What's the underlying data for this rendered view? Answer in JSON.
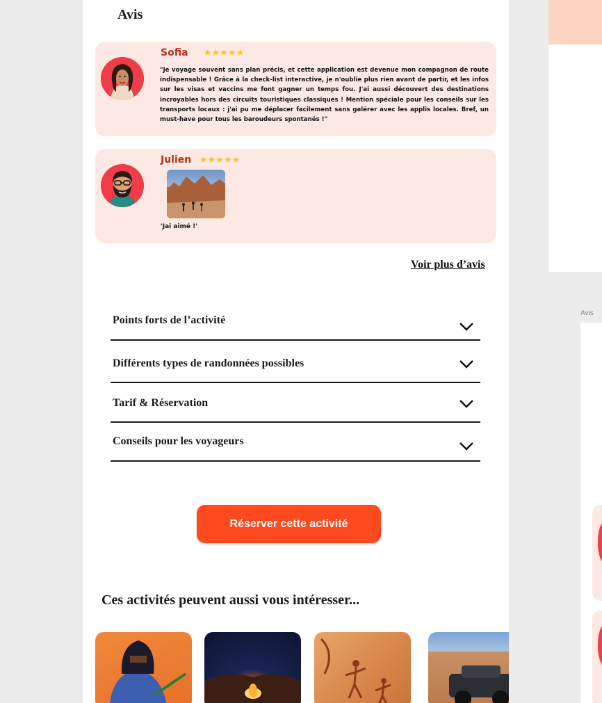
{
  "reviews": {
    "title": "Avis",
    "items": [
      {
        "name": "Sofia",
        "stars": "★★★★★",
        "text": "\"Je voyage souvent sans plan précis, et cette application est devenue mon compagnon de route indispensable ! Grâce à la check-list interactive, je n'oublie plus rien avant de partir, et les infos sur les visas et vaccins me font gagner un temps fou. J'ai aussi découvert des destinations incroyables hors des circuits touristiques classiques ! Mention spéciale pour les conseils sur les transports locaux : j'ai pu me déplacer facilement sans galérer avec les applis locales. Bref, un must-have pour tous les baroudeurs spontanés !\""
      },
      {
        "name": "Julien",
        "stars": "★★★★★",
        "text": "'Jai aimé !'"
      }
    ],
    "more_link": "Voir plus d’avis"
  },
  "accordion": [
    {
      "label": "Points forts de l’activité"
    },
    {
      "label": "Différents types de randonnées possibles"
    },
    {
      "label": "Tarif & Réservation"
    },
    {
      "label": "Conseils pour les voyageurs"
    }
  ],
  "cta": {
    "label": "Réserver cette activité"
  },
  "related": {
    "title": "Ces activités peuvent aussi vous intéresser..."
  },
  "side": {
    "label": "Avis"
  },
  "colors": {
    "accent": "#ff4a1f",
    "review_bg": "#fde9e3",
    "avatar_bg": "#ef3c46",
    "reviewer_name": "#b5321e",
    "star": "#f4c430"
  }
}
